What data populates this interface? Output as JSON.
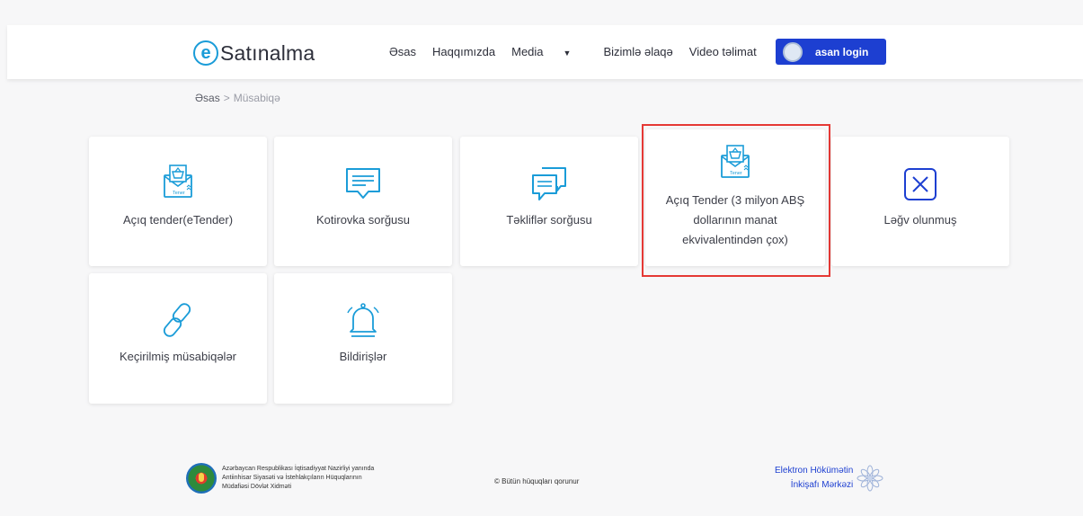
{
  "header": {
    "logo_letter": "e",
    "logo_text": "Satınalma",
    "nav": [
      {
        "label": "Əsas"
      },
      {
        "label": "Haqqımızda"
      },
      {
        "label": "Media"
      },
      {
        "label": "Bizimlə əlaqə"
      },
      {
        "label": "Video təlimat"
      }
    ],
    "asan_login": "asan login"
  },
  "breadcrumb": {
    "home": "Əsas",
    "separator": ">",
    "current": "Müsabiqə"
  },
  "cards": [
    {
      "label": "Açıq tender(eTender)",
      "icon": "tender-envelope-icon",
      "icon_text": "Tener"
    },
    {
      "label": "Kotirovka sorğusu",
      "icon": "message-icon"
    },
    {
      "label": "Təkliflər sorğusu",
      "icon": "messages-icon"
    },
    {
      "label": "Açıq Tender (3 milyon ABŞ dollarının manat ekvivalentindən çox)",
      "icon": "tender-envelope-icon",
      "icon_text": "Tener"
    },
    {
      "label": "Ləğv olunmuş",
      "icon": "cancel-icon"
    },
    {
      "label": "Keçirilmiş müsabiqələr",
      "icon": "link-icon"
    },
    {
      "label": "Bildirişlər",
      "icon": "bell-icon"
    }
  ],
  "footer": {
    "left_text": [
      "Azərbaycan Respublikası İqtisadiyyat Nazirliyi yanında",
      "Antiinhisar Siyasəti və İstehlakçıların Hüquqlarının",
      "Müdafiəsi Dövlət Xidməti"
    ],
    "copyright": "© Bütün hüquqları qorunur",
    "right_text": [
      "Elektron Hökümətin",
      "İnkişafı Mərkəzi"
    ]
  },
  "colors": {
    "accent_blue": "#1a9cd8",
    "button_blue": "#1d3fd1",
    "highlight_red": "#e53935"
  }
}
